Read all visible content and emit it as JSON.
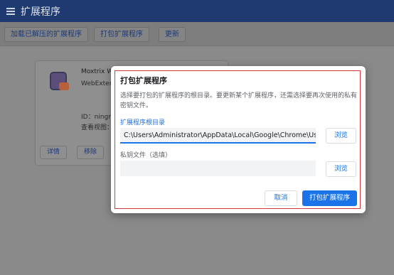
{
  "topbar": {
    "title": "扩展程序"
  },
  "toolbar": {
    "load_unpacked": "加载已解压的扩展程序",
    "pack": "打包扩展程序",
    "update": "更新"
  },
  "card": {
    "name": "Moxtrix W",
    "subtitle": "WebExten",
    "id_label": "ID：ningn",
    "view_label": "查看视图：",
    "details_btn": "详情",
    "remove_btn": "移除"
  },
  "dialog": {
    "title": "打包扩展程序",
    "description": "选择要打包的扩展程序的根目录。要更新某个扩展程序，还需选择要再次使用的私有密钥文件。",
    "root_label": "扩展程序根目录",
    "root_value": "C:\\Users\\Administrator\\AppData\\Local\\Google\\Chrome\\User Data",
    "key_label": "私钥文件（选填）",
    "key_value": "",
    "browse_label": "浏览",
    "cancel_label": "取消",
    "pack_label": "打包扩展程序"
  },
  "colors": {
    "accent": "#1a73e8",
    "highlight": "#d43a3a"
  }
}
